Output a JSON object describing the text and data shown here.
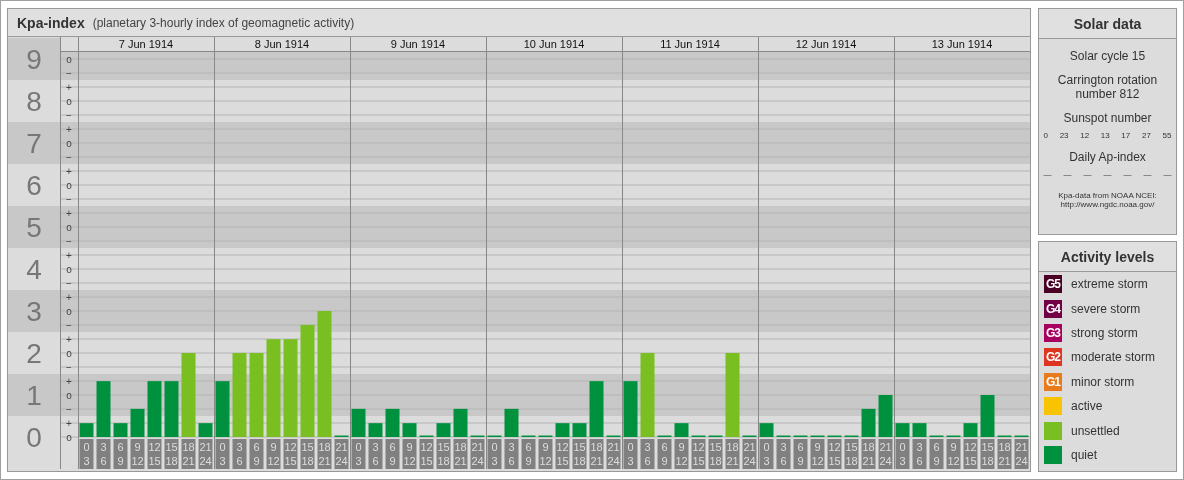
{
  "header": {
    "title": "Kpa-index",
    "subtitle": "(planetary 3-hourly index of geomagnetic activity)"
  },
  "chart": {
    "days": [
      "7 Jun 1914",
      "8 Jun 1914",
      "9 Jun 1914",
      "10 Jun 1914",
      "11 Jun 1914",
      "12 Jun 1914",
      "13 Jun 1914"
    ],
    "minor_tick_labels": [
      "o",
      "−",
      "+",
      "o",
      "−",
      "+",
      "o",
      "−",
      "+",
      "o",
      "−",
      "+",
      "o",
      "−",
      "+",
      "o",
      "−",
      "+",
      "o",
      "−",
      "+",
      "o",
      "−",
      "+",
      "o",
      "−",
      "+",
      "o"
    ],
    "chart_data": {
      "type": "bar",
      "ylim": [
        0,
        9
      ],
      "grid": true,
      "yticks": [
        0,
        1,
        2,
        3,
        4,
        5,
        6,
        7,
        8,
        9
      ],
      "categories": [
        "0 3",
        "3 6",
        "6 9",
        "9 12",
        "12 15",
        "15 18",
        "18 21",
        "21 24",
        "0 3",
        "3 6",
        "6 9",
        "9 12",
        "12 15",
        "15 18",
        "18 21",
        "21 24",
        "0 3",
        "3 6",
        "6 9",
        "9 12",
        "12 15",
        "15 18",
        "18 21",
        "21 24",
        "0 3",
        "3 6",
        "6 9",
        "9 12",
        "12 15",
        "15 18",
        "18 21",
        "21 24",
        "0 3",
        "3 6",
        "6 9",
        "9 12",
        "12 15",
        "15 18",
        "18 21",
        "21 24",
        "0 3",
        "3 6",
        "6 9",
        "9 12",
        "12 15",
        "15 18",
        "18 21",
        "21 24",
        "0 3",
        "3 6",
        "6 9",
        "9 12",
        "12 15",
        "15 18",
        "18 21",
        "21 24"
      ],
      "series": [
        {
          "color": "#00913f",
          "values": [
            0.33,
            1.33,
            0.33,
            0.67,
            1.33,
            1.33,
            null,
            0.33,
            1.33,
            null,
            null,
            null,
            null,
            null,
            null,
            0,
            0.67,
            0.33,
            0.67,
            0.33,
            0,
            0.33,
            0.67,
            0,
            0,
            0.67,
            0,
            0,
            0.33,
            0.33,
            1.33,
            0,
            1.33,
            null,
            0,
            0.33,
            0,
            0,
            null,
            0,
            0.33,
            0,
            0,
            0,
            0,
            0,
            0.67,
            1,
            0.33,
            0.33,
            0,
            0,
            0.33,
            1,
            0,
            0
          ]
        },
        {
          "color": "#7abf21",
          "values": [
            null,
            null,
            null,
            null,
            null,
            null,
            2,
            null,
            null,
            2,
            2,
            2.33,
            2.33,
            2.67,
            3,
            null,
            null,
            null,
            null,
            null,
            null,
            null,
            null,
            null,
            null,
            null,
            null,
            null,
            null,
            null,
            null,
            null,
            null,
            2,
            null,
            null,
            null,
            null,
            2,
            null,
            null,
            null,
            null,
            null,
            null,
            null,
            null,
            null,
            null,
            null,
            null,
            null,
            null,
            null,
            null,
            null
          ]
        }
      ]
    }
  },
  "solar_data": {
    "title": "Solar data",
    "cycle": "Solar cycle 15",
    "rotation": "Carrington rotation number 812",
    "sunspot_title": "Sunspot number",
    "sunspot_numbers": [
      "0",
      "23",
      "12",
      "13",
      "17",
      "27",
      "55"
    ],
    "ap_title": "Daily Ap-index",
    "ap_values": [
      "—",
      "—",
      "—",
      "—",
      "—",
      "—",
      "—"
    ],
    "source": "Kpa-data from NOAA NCEI:",
    "source_url": "http://www.ngdc.noaa.gov/"
  },
  "activity_levels": {
    "title": "Activity levels",
    "items": [
      {
        "badge": "G5",
        "label": "extreme storm",
        "color": "#4a0025"
      },
      {
        "badge": "G4",
        "label": "severe storm",
        "color": "#720046"
      },
      {
        "badge": "G3",
        "label": "strong storm",
        "color": "#a8005e"
      },
      {
        "badge": "G2",
        "label": "moderate storm",
        "color": "#dc3620"
      },
      {
        "badge": "G1",
        "label": "minor storm",
        "color": "#e87b1c"
      },
      {
        "label": "active",
        "color": "#f8c300"
      },
      {
        "label": "unsettled",
        "color": "#7abf21"
      },
      {
        "label": "quiet",
        "color": "#00913f"
      }
    ]
  }
}
